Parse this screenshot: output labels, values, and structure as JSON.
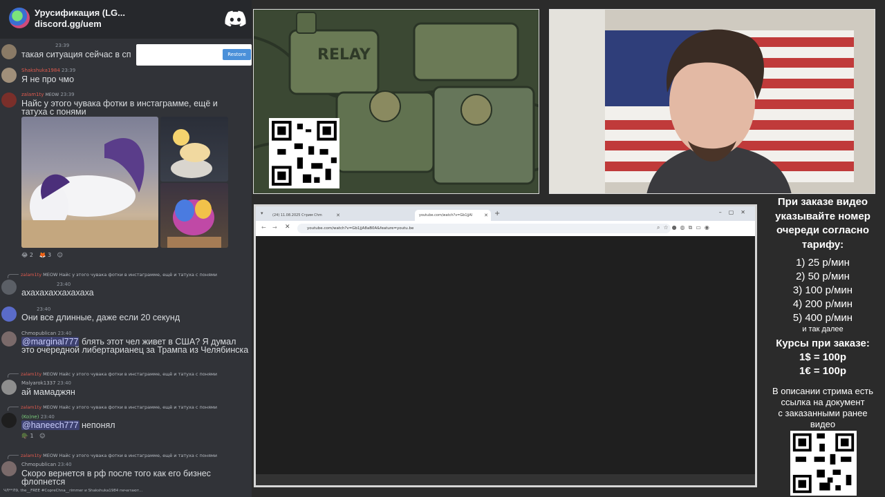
{
  "chat": {
    "server_name": "Урусификация (LG...",
    "server_link": "discord.gg/uem",
    "restore_label": "Restore",
    "messages": [
      {
        "time": "23:39",
        "text": "такая ситуация сейчас в сп"
      },
      {
        "author": "Shakshuka1984",
        "time": "23:39",
        "text": "Я не про чмо"
      },
      {
        "author": "zalam1ty",
        "badge": "MEOW",
        "time": "23:39",
        "text": "Найс у этого чувака фотки в инстаграмме, ещё и татуха с понями",
        "reactions": [
          "😂 2",
          "🦊 3",
          "☺"
        ]
      },
      {
        "reply_author": "zalam1ty",
        "reply_badge": "MEOW",
        "reply_text": "Найс у этого чувака фотки в инстаграмме, ещё и татуха с понями",
        "time": "23:40",
        "text": "ахахахаххахахаха"
      },
      {
        "time": "23:40",
        "text": "Они все длинные, даже если 20 секунд"
      },
      {
        "author": "Chmopublican",
        "time": "23:40",
        "mention": "@marginal777",
        "text": " блять этот чел живет в США? Я думал это очередной либертарианец за Трампа из Челябинска"
      },
      {
        "reply_author": "zalam1ty",
        "reply_badge": "MEOW",
        "reply_text": "Найс у этого чувака фотки в инстаграмме, ещё и татуха с понями",
        "author": "Malyarok1337",
        "time": "23:40",
        "text": "ай мамаджян"
      },
      {
        "reply_author": "zalam1ty",
        "reply_badge": "MEOW",
        "reply_text": "Найс у этого чувака фотки в инстаграмме, ещё и татуха с понями",
        "author": "(Ko)ne)",
        "time": "23:40",
        "mention": "@haneech777",
        "text": " непонял",
        "reactions": [
          "🪖 1",
          "☺"
        ]
      },
      {
        "reply_author": "zalam1ty",
        "reply_badge": "MEOW",
        "reply_text": "Найс у этого чувака фотки в инстаграмме, ещё и татуха с понями",
        "author": "Chmopublican",
        "time": "23:40",
        "text": "Скоро вернется в рф после того как его бизнес флопнется"
      }
    ],
    "typing": "ЧЛ**Л9, the__FREE #CopreChna__rimmer и Shakshuka1984 печатают..."
  },
  "art": {
    "relay_label": "RELAY"
  },
  "browser": {
    "tab1_title": "(24) 11.08.2025 Стрим Chm",
    "tab2_title": "youtube.com/watch?v=Gb1jjAl",
    "url": "youtube.com/watch?v=Gb1jjA8aB0A&feature=youtu.be"
  },
  "info": {
    "order_lines": [
      "При заказе видео",
      "указывайте номер",
      "очереди согласно",
      "тарифу:"
    ],
    "rates": [
      "1) 25 р/мин",
      "2) 50 р/мин",
      "3) 100 р/мин",
      "4) 200 р/мин",
      "5) 400 р/мин"
    ],
    "rates_more": "и так далее",
    "courses_title": "Курсы при заказе:",
    "courses": [
      "1$ = 100р",
      "1€ = 100р"
    ],
    "desc_lines": [
      "В описании стрима есть",
      "ссылка на документ",
      "с заказанными ранее",
      "видео"
    ]
  },
  "colors": {
    "chat_bg": "#313338",
    "page_bg": "#2b2b2b",
    "mention": "#c9cdfb",
    "author_red": "#e05a4e"
  }
}
